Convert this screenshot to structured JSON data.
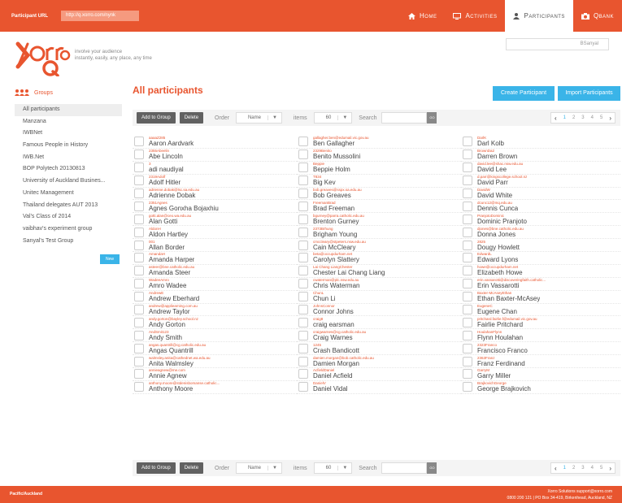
{
  "topbar": {
    "url_label": "Participant URL",
    "url_value": "http://q.xorro.com/nynk",
    "nav": [
      "Home",
      "Activities",
      "Participants",
      "Qbank"
    ]
  },
  "header": {
    "tagline_1": "involve your audience",
    "tagline_2": "instantly, easily, any place, any time",
    "user": "BSanyal"
  },
  "sidebar": {
    "title": "Groups",
    "items": [
      "All participants",
      "Manzana",
      "IWBNet",
      "Famous People in History",
      "IWB.Net",
      "BOP Polytech 20130813",
      "University of Auckland Busines...",
      "Unitec Management",
      "Thailand delegates AUT 2013",
      "Val's Class of 2014",
      "vaibhav's experiment group",
      "Sanyal's Test Group"
    ],
    "new_label": "New"
  },
  "main": {
    "title": "All participants",
    "create_label": "Create Participant",
    "import_label": "Import Participants"
  },
  "toolbar": {
    "add_to_group": "Add to Group",
    "delete": "Delete",
    "order_label": "Order",
    "order_value": "Name",
    "items_label": "items",
    "items_value": "60",
    "search_label": "Search",
    "go": "GO",
    "pages": [
      "1",
      "2",
      "3",
      "4",
      "5"
    ]
  },
  "participants": [
    {
      "u": "aaaaZ285",
      "n": "Aaron Aardvark"
    },
    {
      "u": "gallagher.ben@edumail.vic.gov.au",
      "n": "Ben Gallagher"
    },
    {
      "u": "DarlK",
      "n": "Darl Kolb"
    },
    {
      "u": "2355Abeelin",
      "n": "Abe Lincoln"
    },
    {
      "u": "2329Benito",
      "n": "Benito Mussolini"
    },
    {
      "u": "BrownDa2",
      "n": "Darren Brown"
    },
    {
      "u": "3",
      "n": "adi naudiyal"
    },
    {
      "u": "Beppie",
      "n": "Beppie Holm"
    },
    {
      "u": "david.lee@shac.nsw.edu.au",
      "n": "David Lee"
    },
    {
      "u": "2319Adolf",
      "n": "Adolf Hitler"
    },
    {
      "u": "T834",
      "n": "Big Kev"
    },
    {
      "u": "d.parr@kingscollege.school.nz",
      "n": "David Parr"
    },
    {
      "u": "adrienne.dobak@lsc.sa.edu.au",
      "n": "Adrienne Dobak"
    },
    {
      "u": "bob.greaves@sspx.sa.edu.au",
      "n": "Bob Greaves"
    },
    {
      "u": "DavidW",
      "n": "David White"
    },
    {
      "u": "2351Agnes",
      "n": "Agnes Gonxha Bojaxhiu"
    },
    {
      "u": "FreemanBrad",
      "n": "Brad Freeman"
    },
    {
      "u": "dcunc12@mq.edu.au",
      "n": "Dennis Cunca"
    },
    {
      "u": "gotti.alan@ceo.wa.edu.au",
      "n": "Alan Gotti"
    },
    {
      "u": "bgurney@parra.catholic.edu.au",
      "n": "Brenton Gurney"
    },
    {
      "u": "PranjotoDominic",
      "n": "Dominic Pranjoto"
    },
    {
      "u": "AldonH",
      "n": "Aldon Hartley"
    },
    {
      "u": "2373Brhung",
      "n": "Brigham Young"
    },
    {
      "u": "djones@bne.catholic.edu.au",
      "n": "Donna Jones"
    },
    {
      "u": "001",
      "n": "Allan Border"
    },
    {
      "u": "cmccleary@stpeters.nsw.edu.au",
      "n": "Cain McCleary"
    },
    {
      "u": "2825",
      "n": "Dougy Howlett"
    },
    {
      "u": "AmandaH",
      "n": "Amanda Harper"
    },
    {
      "u": "beta@occupdurham.net",
      "n": "Carolyn Slattery"
    },
    {
      "u": "EdwardL",
      "n": "Edward Lyons"
    },
    {
      "u": "asteer@bne.catholic.edu.au",
      "n": "Amanda Steer"
    },
    {
      "u": "Lai Chang LiangChester",
      "n": "Chester Lai Chang Liang"
    },
    {
      "u": "howe@occupdurham.net",
      "n": "Elizabeth Howe"
    },
    {
      "u": "WadeeAmro",
      "n": "Amro Wadee"
    },
    {
      "u": "cwaterman@plc.nsw.edu.au",
      "n": "Chris Waterman"
    },
    {
      "u": "erin.vassarotti@discoveringfaith.catholic...",
      "n": "Erin Vassarotti"
    },
    {
      "u": "AndrewE",
      "n": "Andrew Eberhard"
    },
    {
      "u": "ChunL",
      "n": "Chun Li"
    },
    {
      "u": "Baxter-McAseyEthan",
      "n": "Ethan Baxter-McAsey"
    },
    {
      "u": "andrew@appliearning.com.au",
      "n": "Andrew Taylor"
    },
    {
      "u": "JohnsConnor",
      "n": "Connor Johns"
    },
    {
      "u": "EugeneC",
      "n": "Eugene Chan"
    },
    {
      "u": "andy.gorton@bayley.school.nz",
      "n": "Andy Gorton"
    },
    {
      "u": "craig8",
      "n": "craig earsman"
    },
    {
      "u": "pritchard.fairlie.f@edumail.vic.gov.au",
      "n": "Fairlie Pritchard"
    },
    {
      "u": "AndSmit123",
      "n": "Andy Smith"
    },
    {
      "u": "craigwarnes@cg.catholic.edu.au",
      "n": "Craig Warnes"
    },
    {
      "u": "HoulahanFlynn",
      "n": "Flynn Houlahan"
    },
    {
      "u": "angas.quantrill@cg.catholic.edu.au",
      "n": "Angas Quantrill"
    },
    {
      "u": "1245",
      "n": "Crash Bandicott"
    },
    {
      "u": "2323Franco",
      "n": "Francisco Franco"
    },
    {
      "u": "walmsley.anita@cathednet.wa.edu.au",
      "n": "Anita Walmsley"
    },
    {
      "u": "damien.morgan@bob.catholic.edu.au",
      "n": "Damien Morgan"
    },
    {
      "u": "2363Franz",
      "n": "Franz Ferdinand"
    },
    {
      "u": "annieagnew@me.com",
      "n": "Annie Agnew"
    },
    {
      "u": "AcfieldDaniel",
      "n": "Daniel Acfield"
    },
    {
      "u": "GarryM",
      "n": "Garry Miller"
    },
    {
      "u": "anthony.moore@stdenisbomanse.catholic...",
      "n": "Anthony Moore"
    },
    {
      "u": "DanielV",
      "n": "Daniel Vidal"
    },
    {
      "u": "BrajkovichGeorge",
      "n": "George Brajkovich"
    }
  ],
  "footer": {
    "left": "Pacific/Auckland",
    "right_1": "Xorro Solutions support@xorro.com",
    "right_2": "0800 200 121 | PO Box 34-419, Birkenhead, Auckland, NZ"
  },
  "colors": {
    "brand": "#e8552f",
    "accent": "#3ab4e8"
  }
}
